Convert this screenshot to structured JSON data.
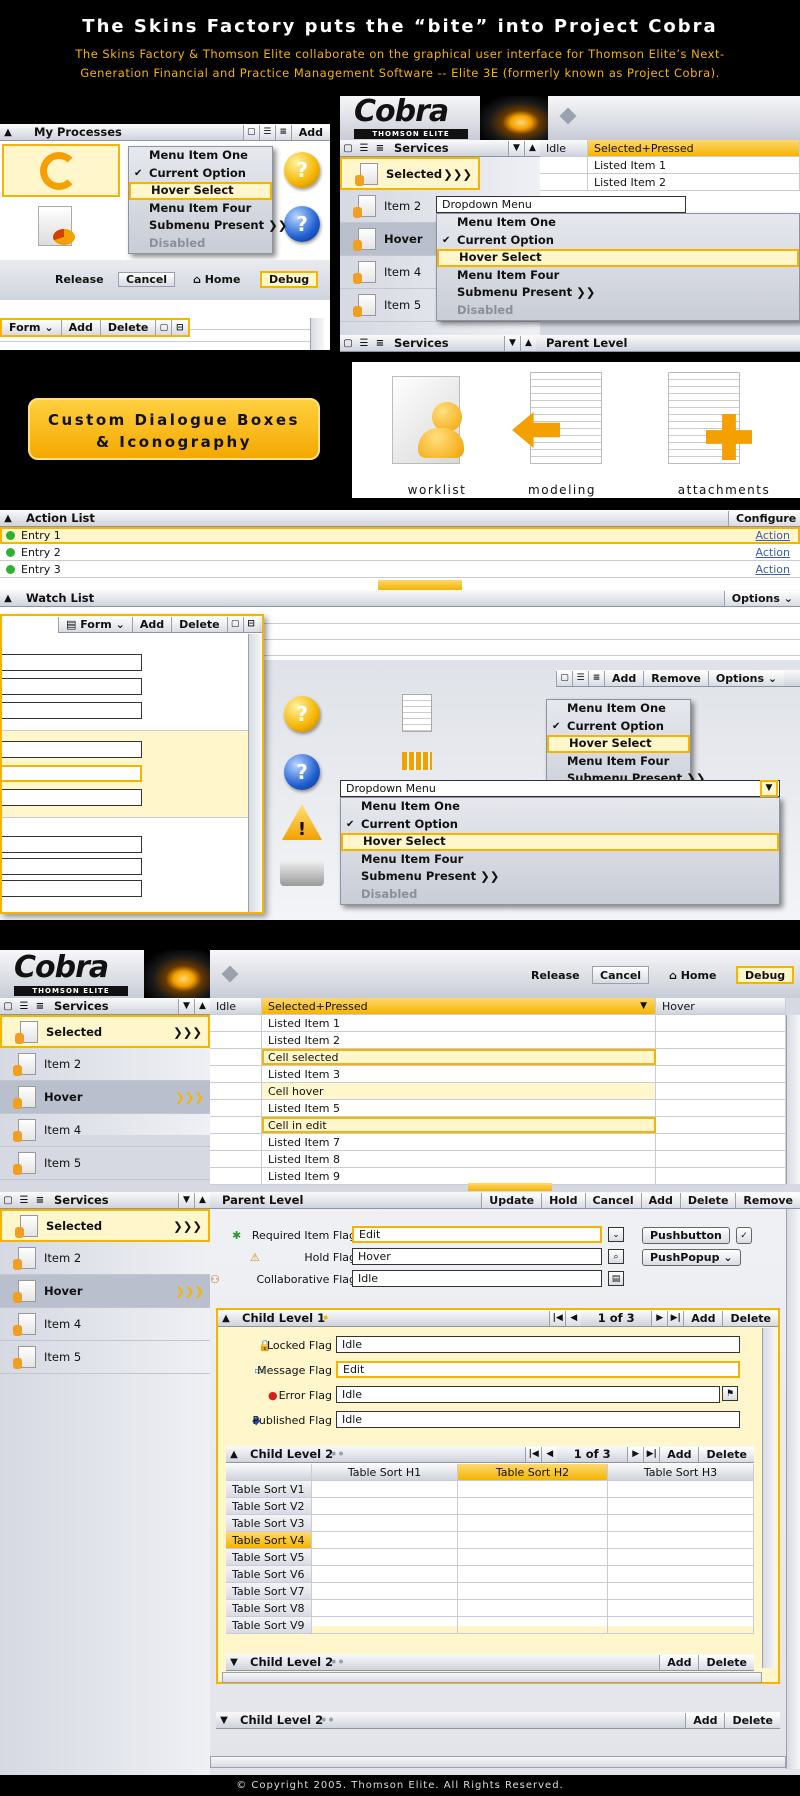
{
  "header": {
    "title": "The Skins Factory puts the “bite” into Project Cobra",
    "subtitle_line1": "The Skins Factory & Thomson Elite collaborate on the graphical user interface for Thomson Elite’s Next-",
    "subtitle_line2": "Generation Financial and Practice Management Software -- Elite 3E (formerly known as Project Cobra)."
  },
  "brand": {
    "logo": "Cobra",
    "sublogo": "THOMSON ELITE"
  },
  "colors": {
    "accent": "#f4b400",
    "highlight_bg": "#fff6cc",
    "panel": "#d6d9e2"
  },
  "section1": {
    "processes": {
      "title": "My Processes",
      "add": "Add"
    },
    "menu": [
      "Menu Item One",
      "Current Option",
      "Hover Select",
      "Menu Item Four",
      "Submenu Present  ❯❯",
      "Disabled"
    ],
    "toolbar": {
      "release": "Release",
      "cancel": "Cancel",
      "home": "Home",
      "debug": "Debug"
    },
    "formbar": {
      "form": "Form",
      "add": "Add",
      "delete": "Delete"
    },
    "services": "Services",
    "grid_head": {
      "idle": "Idle",
      "selected": "Selected+Pressed"
    },
    "grid_rows": [
      "Listed Item 1",
      "Listed Item 2"
    ],
    "dropdown": "Dropdown Menu",
    "side_items": [
      "Selected",
      "Item 2",
      "Hover",
      "Item 4",
      "Item 5"
    ],
    "side_arrows": "❯❯❯",
    "bottom_bar": {
      "services": "Services",
      "parent": "Parent Level"
    }
  },
  "section2": {
    "banner_line1": "Custom Dialogue Boxes",
    "banner_line2": "& Iconography",
    "icons": [
      "worklist",
      "modeling",
      "attachments"
    ]
  },
  "section3": {
    "action_list": {
      "title": "Action List",
      "configure": "Configure",
      "entries": [
        "Entry 1",
        "Entry 2",
        "Entry 3"
      ],
      "action": "Action"
    },
    "watch_list": {
      "title": "Watch List",
      "options": "Options"
    },
    "formbar": {
      "form": "Form",
      "add": "Add",
      "delete": "Delete"
    },
    "toolbar2": {
      "add": "Add",
      "remove": "Remove",
      "options": "Options"
    },
    "dropdown": "Dropdown Menu"
  },
  "section4": {
    "toolbar": {
      "release": "Release",
      "cancel": "Cancel",
      "home": "Home",
      "debug": "Debug"
    },
    "services": "Services",
    "grid_head": {
      "idle": "Idle",
      "selected": "Selected+Pressed",
      "hover": "Hover"
    },
    "grid_rows": [
      "Listed Item 1",
      "Listed Item 2",
      "Cell selected",
      "Listed Item 3",
      "Cell hover",
      "Listed Item 5",
      "Cell in edit",
      "Listed Item 7",
      "Listed Item 8",
      "Listed Item 9"
    ],
    "side_items": [
      "Selected",
      "Item 2",
      "Hover",
      "Item 4",
      "Item 5"
    ],
    "side_arrows": "❯❯❯",
    "parent_bar": {
      "title": "Parent Level",
      "update": "Update",
      "hold": "Hold",
      "cancel": "Cancel",
      "add": "Add",
      "delete": "Delete",
      "remove": "Remove"
    },
    "flags": [
      {
        "label": "Required Item Flag",
        "value": "Edit"
      },
      {
        "label": "Hold Flag",
        "value": "Hover"
      },
      {
        "label": "Collaborative Flag",
        "value": "Idle"
      }
    ],
    "pushbutton": "Pushbutton",
    "pushpopup": "PushPopup",
    "child1": {
      "title": "Child Level 1",
      "pager": "1 of 3",
      "add": "Add",
      "delete": "Delete",
      "flags": [
        {
          "label": "Locked Flag",
          "value": "Idle"
        },
        {
          "label": "Message Flag",
          "value": "Edit"
        },
        {
          "label": "Error Flag",
          "value": "Idle"
        },
        {
          "label": "Published Flag",
          "value": "Idle"
        }
      ]
    },
    "child2": {
      "title": "Child Level 2",
      "pager": "1 of 3",
      "add": "Add",
      "delete": "Delete",
      "headers": [
        "Table Sort H1",
        "Table Sort H2",
        "Table Sort H3"
      ],
      "rows": [
        "Table Sort V1",
        "Table Sort V2",
        "Table Sort V3",
        "Table Sort V4",
        "Table Sort V5",
        "Table Sort V6",
        "Table Sort V7",
        "Table Sort V8",
        "Table Sort V9"
      ]
    },
    "child2b": {
      "title": "Child Level 2",
      "add": "Add",
      "delete": "Delete"
    },
    "child2c": {
      "title": "Child Level 2",
      "add": "Add",
      "delete": "Delete"
    }
  },
  "footer": "© Copyright 2005. Thomson Elite. All Rights Reserved."
}
